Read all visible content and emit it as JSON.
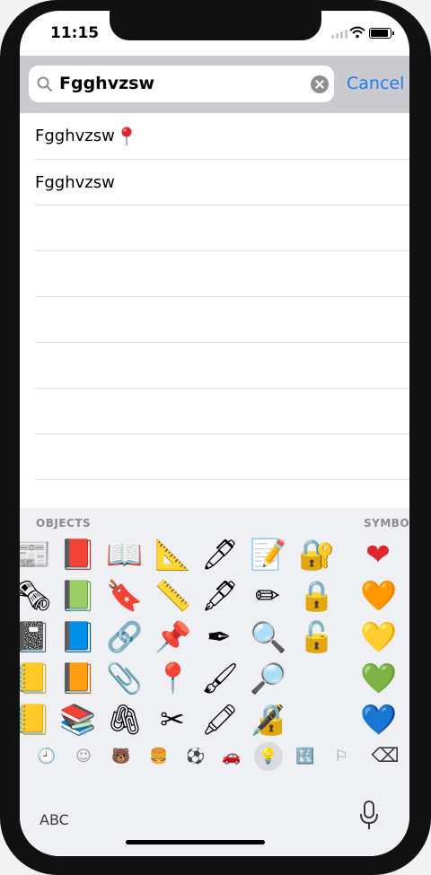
{
  "status_bar": {
    "time": "11:15"
  },
  "search": {
    "query": "Fgghvzsw",
    "cancel_label": "Cancel"
  },
  "results": [
    {
      "label": "Fgghvzsw",
      "marker": "📍"
    },
    {
      "label": "Fgghvzsw",
      "marker": ""
    }
  ],
  "emoji_keyboard": {
    "section_objects": "OBJECTS",
    "section_symbols": "SYMBO",
    "objects_columns": [
      [
        "📰",
        "🗞",
        "📓",
        "📒",
        "📒"
      ],
      [
        "📕",
        "📗",
        "📘",
        "📙",
        "📚"
      ],
      [
        "📖",
        "🔖",
        "🔗",
        "📎",
        "🖇"
      ],
      [
        "📐",
        "📏",
        "📌",
        "📍",
        "✂"
      ],
      [
        "🖊",
        "🖋",
        "✒",
        "🖌",
        "🖍"
      ],
      [
        "📝",
        "✏",
        "🔍",
        "🔎",
        "🔏"
      ],
      [
        "🔐",
        "🔒",
        "🔓",
        "",
        ""
      ]
    ],
    "symbols_column": [
      "❤",
      "🧡",
      "💛",
      "💚",
      "💙"
    ],
    "categories": [
      {
        "name": "recent-icon",
        "glyph": "🕘"
      },
      {
        "name": "smileys-icon",
        "glyph": "☺"
      },
      {
        "name": "animals-icon",
        "glyph": "🐻"
      },
      {
        "name": "food-icon",
        "glyph": "🍔"
      },
      {
        "name": "activity-icon",
        "glyph": "⚽"
      },
      {
        "name": "travel-icon",
        "glyph": "🚗"
      },
      {
        "name": "objects-icon",
        "glyph": "💡"
      },
      {
        "name": "symbols-icon",
        "glyph": "🔣"
      },
      {
        "name": "flags-icon",
        "glyph": "⚐"
      },
      {
        "name": "delete-icon",
        "glyph": "⌫"
      }
    ],
    "abc_label": "ABC"
  },
  "colors": {
    "accent": "#1a7cf6",
    "search_bar_bg": "#c9c9ce",
    "keyboard_bg": "#eef0f3"
  }
}
